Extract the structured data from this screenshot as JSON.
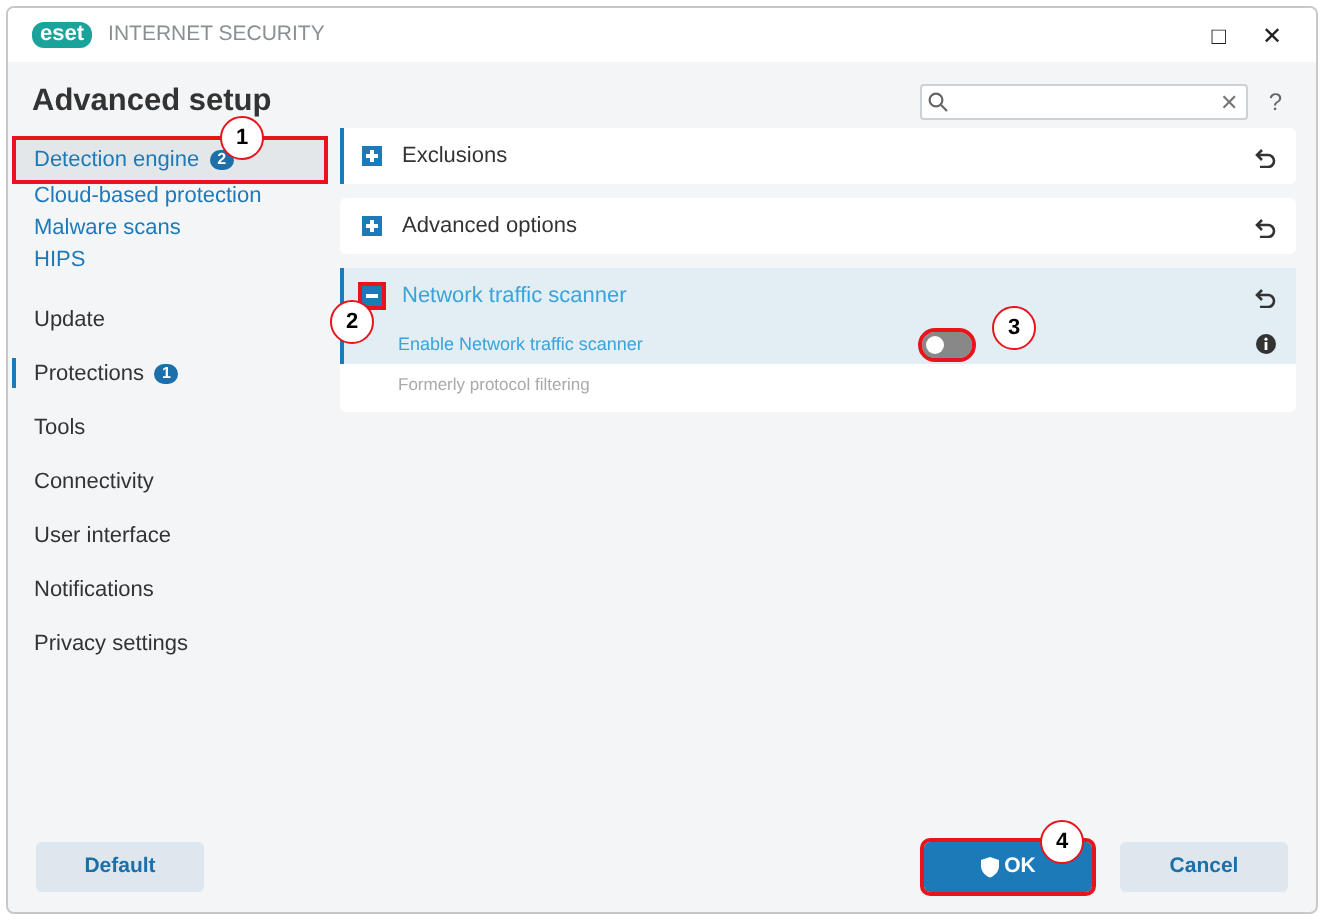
{
  "window": {
    "logo": "eset",
    "title": "INTERNET SECURITY",
    "controls": [
      "□",
      "✕"
    ]
  },
  "header": {
    "title": "Advanced setup",
    "search": {
      "clear": "✕"
    },
    "help": "?"
  },
  "sidebar": {
    "items": [
      {
        "label": "Detection engine",
        "kind": "sub",
        "badge": "2",
        "selected": true,
        "callout": "1"
      },
      {
        "label": "Cloud-based protection",
        "kind": "sub",
        "selected": false
      },
      {
        "label": "Malware scans",
        "kind": "sub",
        "selected": false
      },
      {
        "label": "HIPS",
        "kind": "sub",
        "selected": false
      },
      {
        "label": "Update",
        "kind": "section",
        "selected": false
      },
      {
        "label": "Protections",
        "kind": "section",
        "badge": "1",
        "selected": false,
        "active": true
      },
      {
        "label": "Tools",
        "kind": "section",
        "selected": false
      },
      {
        "label": "Connectivity",
        "kind": "section",
        "selected": false
      },
      {
        "label": "User interface",
        "kind": "section",
        "selected": false
      },
      {
        "label": "Notifications",
        "kind": "section",
        "selected": false
      },
      {
        "label": "Privacy settings",
        "kind": "section",
        "selected": false
      }
    ]
  },
  "sections": [
    {
      "title": "Exclusions",
      "expanded": false,
      "changed": true
    },
    {
      "title": "Advanced options",
      "expanded": false,
      "changed": false
    },
    {
      "title": "Network traffic scanner",
      "expanded": true,
      "changed": true,
      "callout": "2",
      "settings": [
        {
          "label": "Enable Network traffic scanner",
          "on": false,
          "callout": "3",
          "info": true
        }
      ],
      "note": "Formerly protocol filtering"
    }
  ],
  "footer": {
    "buttons": [
      {
        "label": "Default",
        "kind": "secondary"
      },
      {
        "label": "OK",
        "kind": "primary",
        "callout": "4"
      },
      {
        "label": "Cancel",
        "kind": "secondary"
      }
    ]
  }
}
